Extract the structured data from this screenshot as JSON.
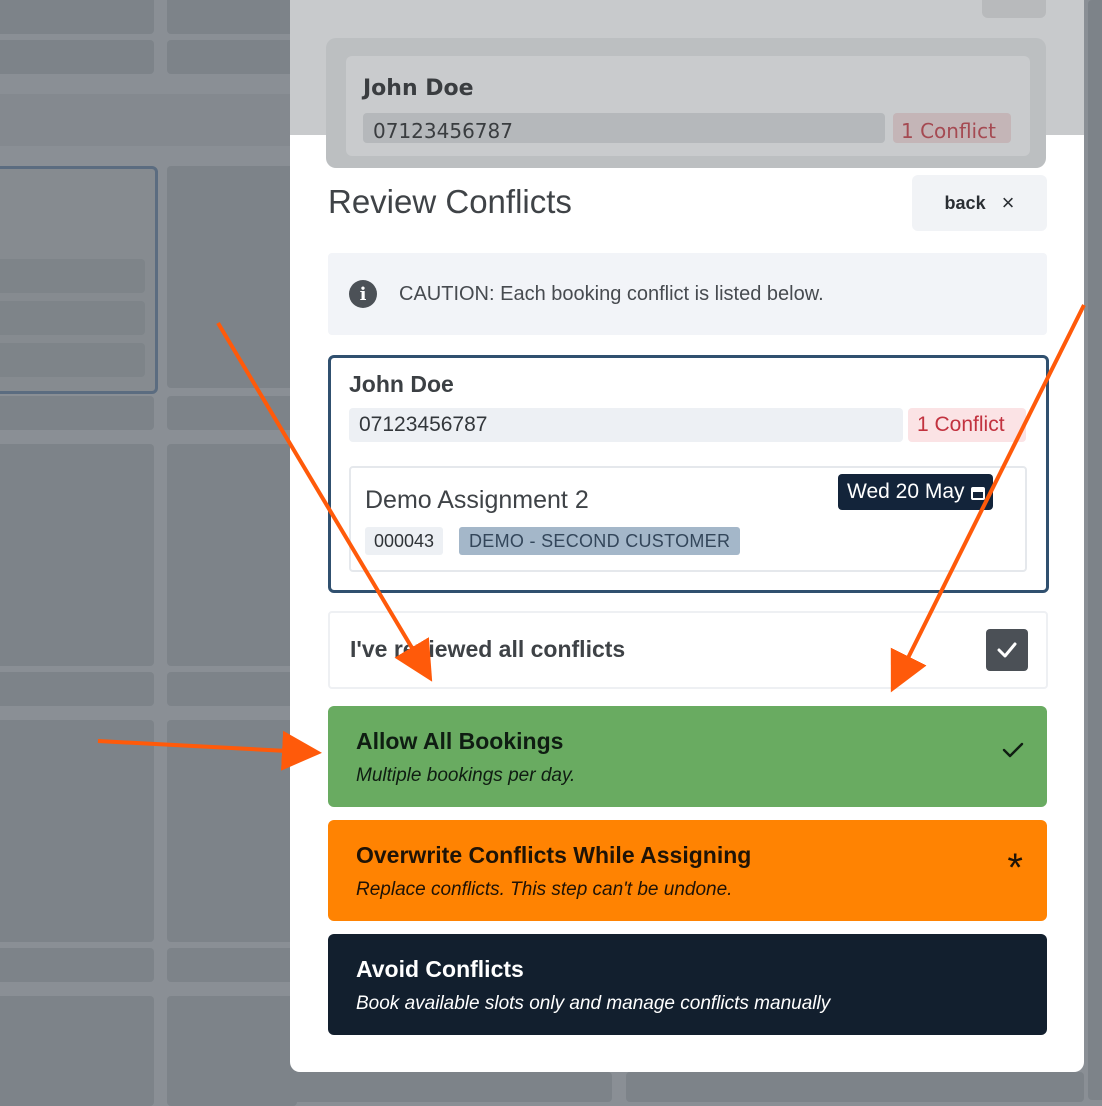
{
  "peek": {
    "name": "John Doe",
    "phone": "07123456787",
    "conflicts": "1 Conflict"
  },
  "modal": {
    "title": "Review Conflicts",
    "back_label": "back",
    "close_glyph": "×",
    "caution_icon": "info-icon",
    "caution_text": "CAUTION: Each booking conflict is listed below."
  },
  "person": {
    "name": "John Doe",
    "phone": "07123456787",
    "conflicts": "1 Conflict",
    "assignment": {
      "title": "Demo Assignment 2",
      "date": "Wed 20 May",
      "date_icon": "calendar-icon",
      "code": "000043",
      "customer": "DEMO - SECOND CUSTOMER"
    }
  },
  "review": {
    "label": "I've reviewed all conflicts",
    "checked": true
  },
  "options": {
    "allow": {
      "title": "Allow All Bookings",
      "subtitle": "Multiple bookings per day.",
      "selected": true,
      "color": "#69ab61"
    },
    "overwrite": {
      "title": "Overwrite Conflicts While Assigning",
      "subtitle": "Replace conflicts. This step can't be undone.",
      "mark": "*",
      "color": "#ff8302"
    },
    "avoid": {
      "title": "Avoid Conflicts",
      "subtitle": "Book available slots only and manage conflicts manually",
      "color": "#121f2e"
    }
  },
  "annotation_color": "#ff5a0a"
}
